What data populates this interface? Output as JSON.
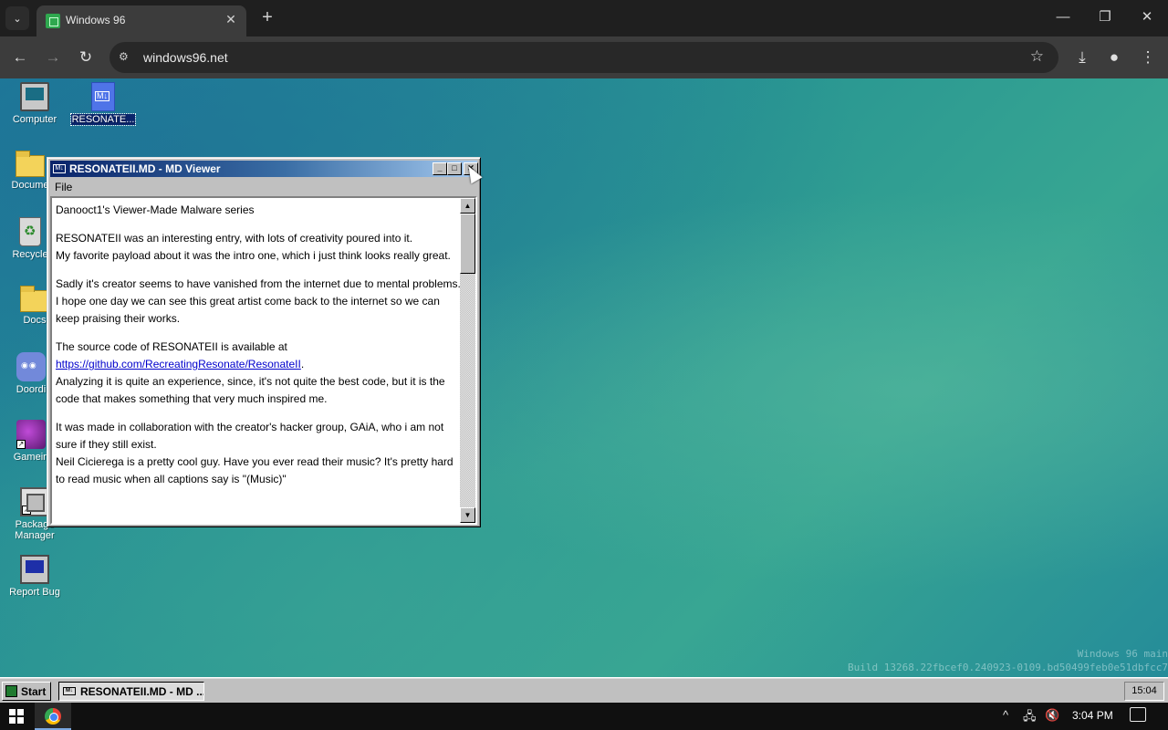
{
  "browser": {
    "tab_title": "Windows 96",
    "url": "windows96.net",
    "tab_close": "✕",
    "new_tab": "+",
    "tab_search": "⌄",
    "back": "←",
    "forward": "→",
    "reload": "↻",
    "site_info": "⚙",
    "bookmark": "☆",
    "download": "⤓",
    "profile": "●",
    "menu": "⋮",
    "minimize": "—",
    "restore": "❐",
    "close": "✕"
  },
  "desktop": {
    "icons": [
      {
        "label": "Computer",
        "icon": "computer-icon"
      },
      {
        "label": "RESONATE...",
        "icon": "markdown-file-icon"
      },
      {
        "label": "Docume",
        "icon": "documents-folder-icon"
      },
      {
        "label": "Recycle",
        "icon": "recycle-bin-icon"
      },
      {
        "label": "Docs",
        "icon": "folder-icon"
      },
      {
        "label": "Doordi",
        "icon": "doordiscord-icon"
      },
      {
        "label": "Gamein",
        "icon": "gamein-icon"
      },
      {
        "label": "Package Manager",
        "icon": "package-manager-icon"
      },
      {
        "label": "Report Bug",
        "icon": "report-bug-icon"
      }
    ],
    "watermark_line1": "Windows 96 main",
    "watermark_line2": "Build 13268.22fbcef0.240923-0109.bd50499feb0e51dbfcc7"
  },
  "viewer": {
    "title": "RESONATEII.MD - MD Viewer",
    "menu_file": "File",
    "btn_min": "_",
    "btn_max": "□",
    "btn_close": "✕",
    "p1": "Danooct1's Viewer-Made Malware series",
    "p2a": "RESONATEII was an interesting entry, with lots of creativity poured into it.",
    "p2b": "My favorite payload about it was the intro one, which i just think looks really great.",
    "p3a": "Sadly it's creator seems to have vanished from the internet due to mental problems.",
    "p3b": "I hope one day we can see this great artist come back to the internet so we can keep praising their works.",
    "p4a": "The source code of RESONATEII is available at",
    "p4_link": "https://github.com/RecreatingResonate/ResonateII",
    "p4_link_end": ".",
    "p4b": "Analyzing it is quite an experience, since, it's not quite the best code, but it is the code that makes something that very much inspired me.",
    "p5a": "It was made in collaboration with the creator's hacker group, GAiA, who i am not sure if they still exist.",
    "p5b": "Neil Cicierega is a pretty cool guy. Have you ever read their music? It's pretty hard to read music when all captions say is \"(Music)\"",
    "scroll_up": "▲",
    "scroll_down": "▼"
  },
  "w96_taskbar": {
    "start_label": "Start",
    "task_label": "RESONATEII.MD - MD ...",
    "clock": "15:04"
  },
  "host_taskbar": {
    "clock": "3:04 PM",
    "tray_chevron": "^",
    "network": "🖧",
    "volume": "🔇"
  }
}
